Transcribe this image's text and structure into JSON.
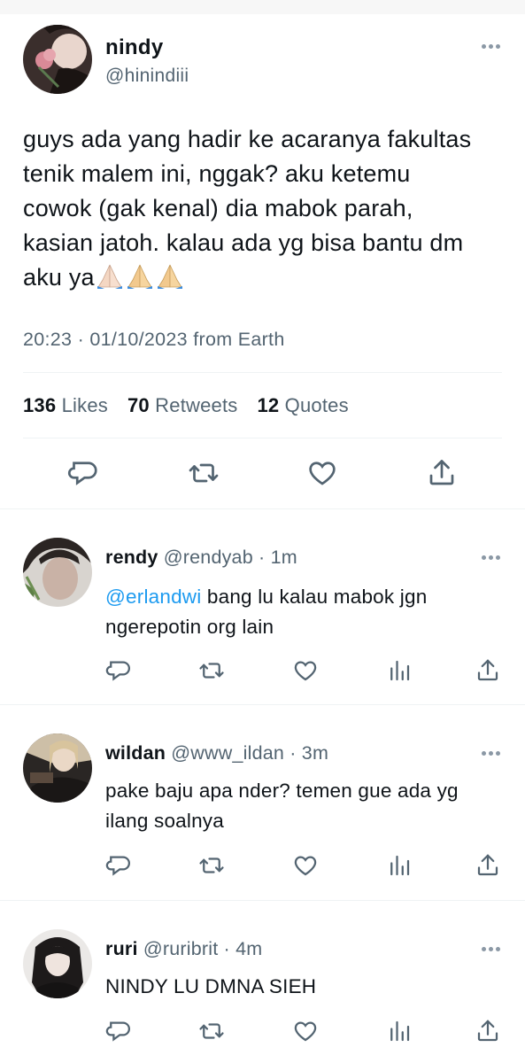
{
  "main_tweet": {
    "name": "nindy",
    "handle": "@hinindiii",
    "text": "guys ada yang hadir ke acaranya fakultas tenik malem ini, nggak? aku ketemu cowok (gak kenal) dia mabok parah, kasian jatoh. kalau ada yg bisa bantu dm aku ya",
    "emoji": "🙏🏻🙏🙏",
    "time": "20:23",
    "date": "01/10/2023",
    "source": "from Earth",
    "likes_count": "136",
    "likes_label": "Likes",
    "retweets_count": "70",
    "retweets_label": "Retweets",
    "quotes_count": "12",
    "quotes_label": "Quotes"
  },
  "replies": [
    {
      "name": "rendy",
      "handle": "@rendyab",
      "time": "1m",
      "mention": "@erlandwi",
      "text": " bang lu kalau mabok jgn ngerepotin org lain"
    },
    {
      "name": "wildan",
      "handle": "@www_ildan",
      "time": "3m",
      "mention": "",
      "text": "pake baju apa nder? temen gue ada yg ilang soalnya"
    },
    {
      "name": "ruri",
      "handle": "@ruribrit",
      "time": "4m",
      "mention": "",
      "text": "NINDY LU DMNA SIEH"
    }
  ],
  "icons": {
    "reply": "reply-icon",
    "retweet": "retweet-icon",
    "like": "heart-icon",
    "views": "analytics-icon",
    "share": "share-icon",
    "more": "more-icon"
  },
  "colors": {
    "text": "#0f1419",
    "secondary": "#536471",
    "mention": "#1d9bf0",
    "divider": "#eff3f4"
  }
}
